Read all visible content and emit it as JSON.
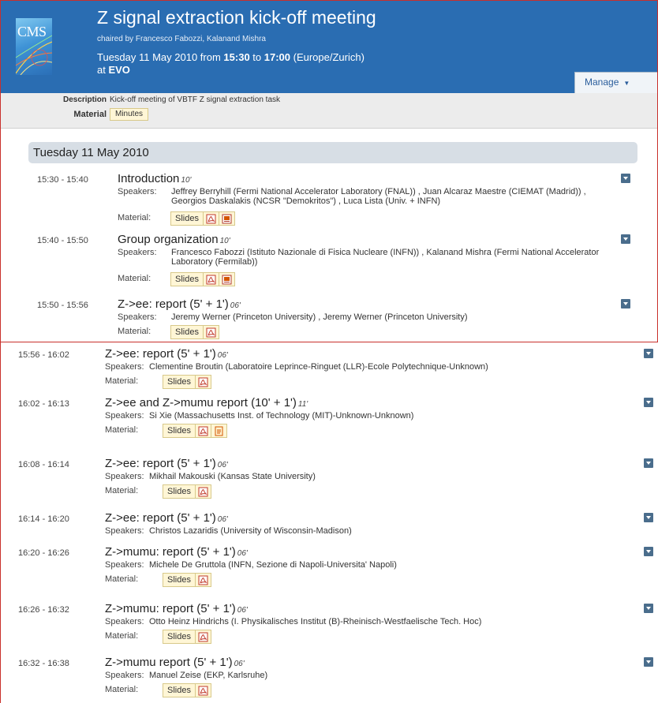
{
  "meeting": {
    "logo_text": "CMS",
    "title": "Z signal extraction kick-off meeting",
    "chairs": "chaired by Francesco Fabozzi, Kalanand Mishra",
    "when_prefix": "Tuesday 11 May 2010 from ",
    "start": "15:30",
    "to": " to ",
    "end": "17:00",
    "tz": " (Europe/Zurich)",
    "at_prefix": "at ",
    "location": "EVO",
    "manage_label": "Manage"
  },
  "info": {
    "description_label": "Description",
    "description": "Kick-off meeting of VBTF Z signal extraction task",
    "material_label": "Material",
    "minutes_label": "Minutes"
  },
  "labels": {
    "speakers": "Speakers:",
    "material": "Material:",
    "slides": "Slides"
  },
  "day_header": "Tuesday 11 May 2010",
  "contributions": [
    {
      "time": "15:30 - 15:40",
      "title": "Introduction",
      "duration": "10'",
      "speakers": "Jeffrey Berryhill (Fermi National Accelerator Laboratory (FNAL)) , Juan Alcaraz Maestre (CIEMAT (Madrid)) , Georgios Daskalakis (NCSR \"Demokritos\") , Luca Lista (Univ. + INFN)",
      "files": [
        "pdf-icon",
        "ppt-icon"
      ]
    },
    {
      "time": "15:40 - 15:50",
      "title": "Group organization",
      "duration": "10'",
      "speakers": "Francesco Fabozzi (Istituto Nazionale di Fisica Nucleare (INFN)) , Kalanand Mishra (Fermi National Accelerator Laboratory (Fermilab))",
      "files": [
        "pdf-icon",
        "ppt-icon"
      ]
    },
    {
      "time": "15:50 - 15:56",
      "title": "Z->ee: report (5' + 1')",
      "duration": "06'",
      "speakers": "Jeremy Werner (Princeton University) , Jeremy Werner (Princeton University)",
      "files": [
        "pdf-icon"
      ]
    },
    {
      "time": "15:56 - 16:02",
      "title": "Z->ee: report (5' + 1')",
      "duration": "06'",
      "speakers": "Clementine Broutin (Laboratoire Leprince-Ringuet (LLR)-Ecole Polytechnique-Unknown)",
      "files": [
        "pdf-icon"
      ]
    },
    {
      "time": "16:02 - 16:13",
      "title": "Z->ee and Z->mumu report (10' + 1')",
      "duration": "11'",
      "speakers": "Si Xie (Massachusetts Inst. of Technology (MIT)-Unknown-Unknown)",
      "files": [
        "pdf-icon",
        "odp-icon"
      ]
    },
    {
      "time": "16:08 - 16:14",
      "title": "Z->ee: report (5' + 1')",
      "duration": "06'",
      "speakers": "Mikhail Makouski (Kansas State University)",
      "files": [
        "pdf-icon"
      ]
    },
    {
      "time": "16:14 - 16:20",
      "title": "Z->ee: report (5' + 1')",
      "duration": "06'",
      "speakers": "Christos Lazaridis (University of Wisconsin-Madison)",
      "files": []
    },
    {
      "time": "16:20 - 16:26",
      "title": "Z->mumu: report (5' + 1')",
      "duration": "06'",
      "speakers": "Michele De Gruttola (INFN, Sezione di Napoli-Universita' Napoli)",
      "files": [
        "pdf-icon"
      ]
    },
    {
      "time": "16:26 - 16:32",
      "title": "Z->mumu: report (5' + 1')",
      "duration": "06'",
      "speakers": "Otto Heinz Hindrichs (I. Physikalisches Institut (B)-Rheinisch-Westfaelische Tech. Hoc)",
      "files": [
        "pdf-icon"
      ]
    },
    {
      "time": "16:32 - 16:38",
      "title": "Z->mumu report (5' + 1')",
      "duration": "06'",
      "speakers": "Manuel Zeise (EKP, Karlsruhe)",
      "files": [
        "pdf-icon"
      ]
    }
  ],
  "colors": {
    "header_bg": "#2a6db2",
    "frame_red": "#c9302c",
    "material_bg": "#fff6d6",
    "menu_button": "#4a6d8c"
  }
}
